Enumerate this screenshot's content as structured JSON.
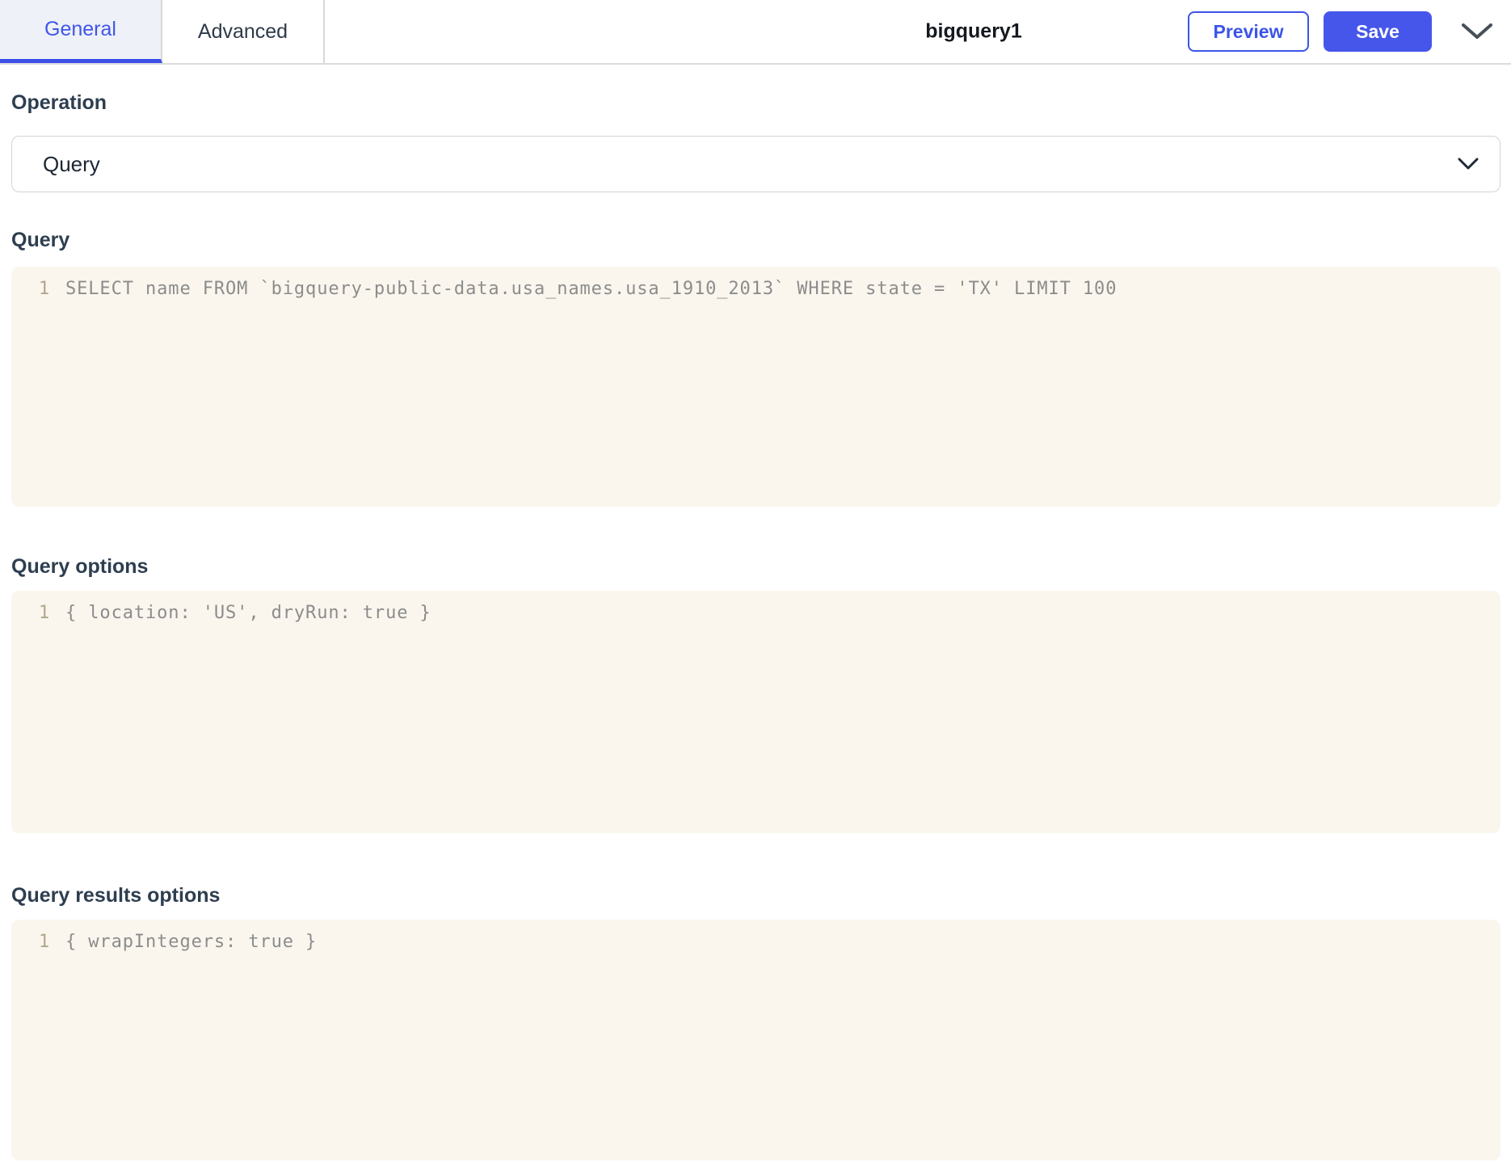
{
  "tabs": {
    "general": "General",
    "advanced": "Advanced"
  },
  "header": {
    "title": "bigquery1",
    "preview_label": "Preview",
    "save_label": "Save"
  },
  "operation": {
    "label": "Operation",
    "selected_value": "Query"
  },
  "query": {
    "label": "Query",
    "line_number": "1",
    "code": "SELECT name FROM `bigquery-public-data.usa_names.usa_1910_2013` WHERE state = 'TX' LIMIT 100"
  },
  "query_options": {
    "label": "Query options",
    "line_number": "1",
    "code": "{ location: 'US', dryRun: true }"
  },
  "query_results_options": {
    "label": "Query results options",
    "line_number": "1",
    "code": "{ wrapIntegers: true }"
  },
  "icons": {
    "select_chevron": "chevron-down",
    "panel_chevron": "chevron-down"
  },
  "colors": {
    "accent_blue": "#3c54e8",
    "save_button_bg": "#4656ea",
    "active_tab_bg": "#eef1f7",
    "active_tab_underline": "#3b4fe8",
    "editor_bg": "#faf6ee",
    "line_number": "#b2a68a",
    "code_text": "#8c8c8c",
    "label_text": "#2e3e50",
    "border_gray": "#d6d8da"
  }
}
